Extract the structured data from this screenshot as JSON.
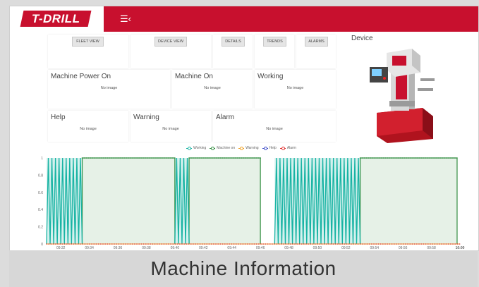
{
  "header": {
    "logo_text": "T-DRILL",
    "menu_icon": "menu-collapse-icon",
    "brand_color": "#c8102e"
  },
  "nav": {
    "buttons": [
      "FLEET VIEW",
      "DEVICE VIEW",
      "DETAILS",
      "TRENDS",
      "ALARMS"
    ]
  },
  "cards": {
    "machine_power_on": {
      "title": "Machine Power On",
      "content": "No image"
    },
    "machine_on": {
      "title": "Machine On",
      "content": "No image"
    },
    "working": {
      "title": "Working",
      "content": "No image"
    },
    "help": {
      "title": "Help",
      "content": "No image"
    },
    "warning": {
      "title": "Warning",
      "content": "No image"
    },
    "alarm": {
      "title": "Alarm",
      "content": "No image"
    }
  },
  "device": {
    "title": "Device"
  },
  "chart_data": {
    "type": "line",
    "legend_position": "top",
    "ylim": [
      0,
      1
    ],
    "y_ticks": [
      "0",
      "0.2",
      "0.4",
      "0.6",
      "0.8",
      "1"
    ],
    "x_ticks": [
      "09:32",
      "09:34",
      "09:36",
      "09:38",
      "09:40",
      "09:42",
      "09:44",
      "09:46",
      "09:48",
      "09:50",
      "09:52",
      "09:54",
      "09:56",
      "09:58",
      "10:00"
    ],
    "x_range": [
      "09:31",
      "10:00"
    ],
    "grid": false,
    "series": [
      {
        "name": "Working",
        "color": "#17b3a3",
        "on_intervals": [
          [
            "09:31",
            "09:33.5"
          ],
          [
            "09:40",
            "09:41"
          ],
          [
            "09:47",
            "09:53"
          ]
        ],
        "oscillating": true
      },
      {
        "name": "Machine on",
        "color": "#2e8b3d",
        "on_intervals": [
          [
            "09:33.5",
            "09:40"
          ],
          [
            "09:41",
            "09:46"
          ],
          [
            "09:53",
            "09:59.8"
          ]
        ],
        "oscillating": false
      },
      {
        "name": "Warning",
        "color": "#f0a020",
        "value": 0
      },
      {
        "name": "Help",
        "color": "#3b4bc8",
        "value": 0
      },
      {
        "name": "Alarm",
        "color": "#e0302e",
        "value": 0
      }
    ]
  },
  "caption": {
    "text": "Machine Information"
  }
}
